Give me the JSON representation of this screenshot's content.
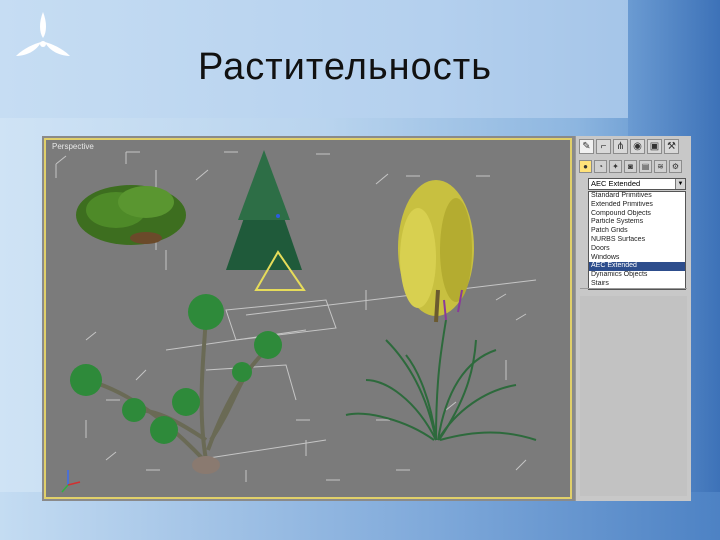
{
  "slide": {
    "title": "Растительность"
  },
  "viewport": {
    "label": "Perspective"
  },
  "command_panel": {
    "tabs": [
      "create-icon",
      "modify-icon",
      "hierarchy-icon",
      "motion-icon",
      "display-icon",
      "utilities-icon"
    ],
    "category_buttons": [
      "geometry-icon",
      "shapes-icon",
      "lights-icon",
      "cameras-icon",
      "helpers-icon",
      "spacewarps-icon",
      "systems-icon"
    ],
    "dropdown_value": "AEC Extended",
    "dropdown_options": [
      "Standard Primitives",
      "Extended Primitives",
      "Compound Objects",
      "Particle Systems",
      "Patch Grids",
      "NURBS Surfaces",
      "Doors",
      "Windows",
      "AEC Extended",
      "Dynamics Objects",
      "Stairs"
    ],
    "selected_option_index": 8
  },
  "colors": {
    "viewport_bg": "#7b7b7b",
    "viewport_border": "#e1d06a",
    "selection": "#2d4d8c"
  }
}
